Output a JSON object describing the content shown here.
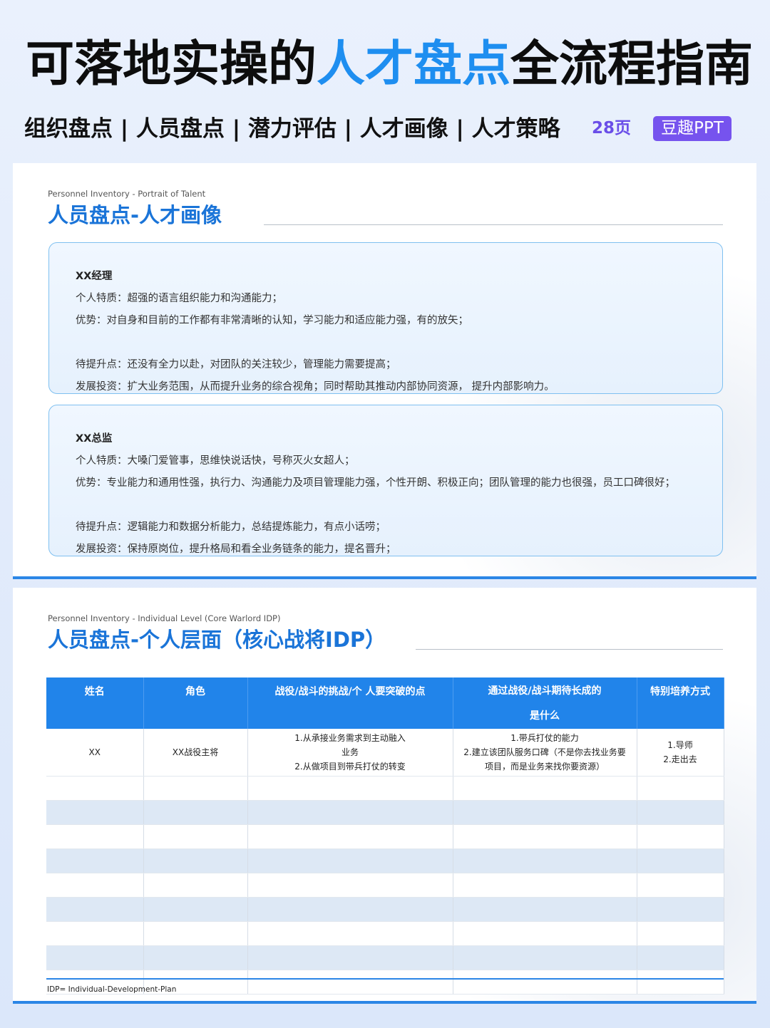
{
  "header": {
    "title_part1": "可落地实操的",
    "title_highlight": "人才盘点",
    "title_part2": "全流程指南",
    "subtitle": "组织盘点 | 人员盘点 | 潜力评估 | 人才画像 | 人才策略",
    "pages": "28页",
    "brand": "豆趣PPT"
  },
  "slide1": {
    "eyebrow": "Personnel Inventory - Portrait of Talent",
    "title": "人员盘点-人才画像",
    "cards": [
      {
        "name": "XX经理",
        "traits": "个人特质：超强的语言组织能力和沟通能力；",
        "strengths": "优势：对自身和目前的工作都有非常清晰的认知，学习能力和适应能力强，有的放矢；",
        "improve": "待提升点：还没有全力以赴，对团队的关注较少，管理能力需要提高；",
        "invest": "发展投资：扩大业务范围，从而提升业务的综合视角；同时帮助其推动内部协同资源，  提升内部影响力。"
      },
      {
        "name": "XX总监",
        "traits": "个人特质：大嗓门爱管事，思维快说话快，号称灭火女超人；",
        "strengths": "优势：专业能力和通用性强，执行力、沟通能力及项目管理能力强，个性开朗、积极正向；团队管理的能力也很强，员工口碑很好；",
        "improve": "待提升点：逻辑能力和数据分析能力，总结提炼能力，有点小话唠；",
        "invest": "发展投资：保持原岗位，提升格局和看全业务链条的能力，提名晋升；"
      }
    ]
  },
  "slide2": {
    "eyebrow": "Personnel Inventory - Individual Level (Core Warlord IDP)",
    "title": "人员盘点-个人层面（核心战将IDP）",
    "table": {
      "headers": [
        "姓名",
        "角色",
        "战役/战斗的挑战/个 人要突破的点",
        "通过战役/战斗期待长成的",
        "特别培养方式"
      ],
      "header4_line2": "是什么",
      "row": {
        "name": "XX",
        "role": "XX战役主将",
        "challenge": [
          "1.从承接业务需求到主动融入",
          "业务",
          "2.从做项目到带兵打仗的转变"
        ],
        "growth": [
          "1.带兵打仗的能力",
          "2.建立该团队服务口碑（不是你去找业务要",
          "项目，而是业务来找你要资源）"
        ],
        "training": [
          "1.导师",
          "2.走出去"
        ]
      }
    },
    "footnote": "IDP= Individual-Development-Plan"
  }
}
